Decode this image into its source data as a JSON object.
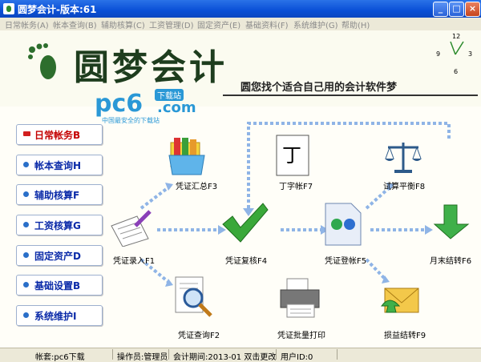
{
  "window": {
    "title": "圆梦会计-版本:61",
    "minimize_glyph": "_",
    "maximize_glyph": "□",
    "close_glyph": "×"
  },
  "menu": {
    "items": [
      {
        "label": "日常帐务(A)"
      },
      {
        "label": "帐本查询(B)"
      },
      {
        "label": "辅助核算(C)"
      },
      {
        "label": "工资管理(D)"
      },
      {
        "label": "固定资产(E)"
      },
      {
        "label": "基础资料(F)"
      },
      {
        "label": "系统维护(G)"
      },
      {
        "label": "帮助(H)"
      }
    ]
  },
  "header": {
    "logo_text": "圆梦会计",
    "slogan": "圆您找个适合自己用的会计软件梦",
    "clock": {
      "label_12": "12",
      "label_3": "3",
      "label_6": "6",
      "label_9": "9"
    }
  },
  "watermark": {
    "brand": "pc6",
    "tag": "下载站",
    "domain": ".com",
    "subtitle": "中国最安全的下载站"
  },
  "sidebar": {
    "items": [
      {
        "label": "日常帐务B",
        "active": true
      },
      {
        "label": "帐本查询H",
        "active": false
      },
      {
        "label": "辅助核算F",
        "active": false
      },
      {
        "label": "工资核算G",
        "active": false
      },
      {
        "label": "固定资产D",
        "active": false
      },
      {
        "label": "基础设置B",
        "active": false
      },
      {
        "label": "系统维护I",
        "active": false
      }
    ]
  },
  "workflow": {
    "voucher_summary": "凭证汇总F3",
    "t_account": "丁字帐F7",
    "t_account_glyph": "丁",
    "trial_balance": "试算平衡F8",
    "voucher_entry": "凭证录入F1",
    "voucher_review": "凭证复核F4",
    "voucher_post": "凭证登帐F5",
    "month_end": "月末结转F6",
    "voucher_query": "凭证查询F2",
    "batch_print": "凭证批量打印",
    "profit_loss": "损益结转F9"
  },
  "status": {
    "account": "帐套:pc6下载",
    "operator": "操作员:管理员",
    "period": "会计期间:2013-01 双击更改",
    "user_id": "用户ID:0"
  },
  "colors": {
    "title_bar": "#0a4fd6",
    "sidebar_text": "#0a2aa8",
    "sidebar_active": "#c40000",
    "flow_arrow": "#8fb4e6",
    "logo_green": "#1e3d1e"
  }
}
